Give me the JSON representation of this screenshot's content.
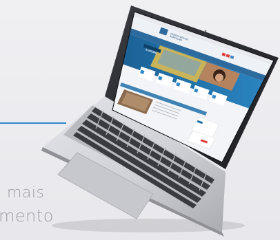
{
  "background": {
    "line1": "mais",
    "line2": "mento"
  },
  "website": {
    "logo_text": "PREFEITURA DE\nSOROCABA",
    "banner_title": "E-SAÚDE",
    "colors": {
      "header": "#6fa7cf",
      "nav": "#2d6a9e",
      "banner": "#1f6fa8",
      "accent": "#2e88c7",
      "badge_red": "#e23a3a",
      "badge_blue": "#3b82c4"
    }
  },
  "icons": [
    "laptop-icon",
    "keyboard-icon",
    "trackpad-icon",
    "webcam-icon"
  ]
}
